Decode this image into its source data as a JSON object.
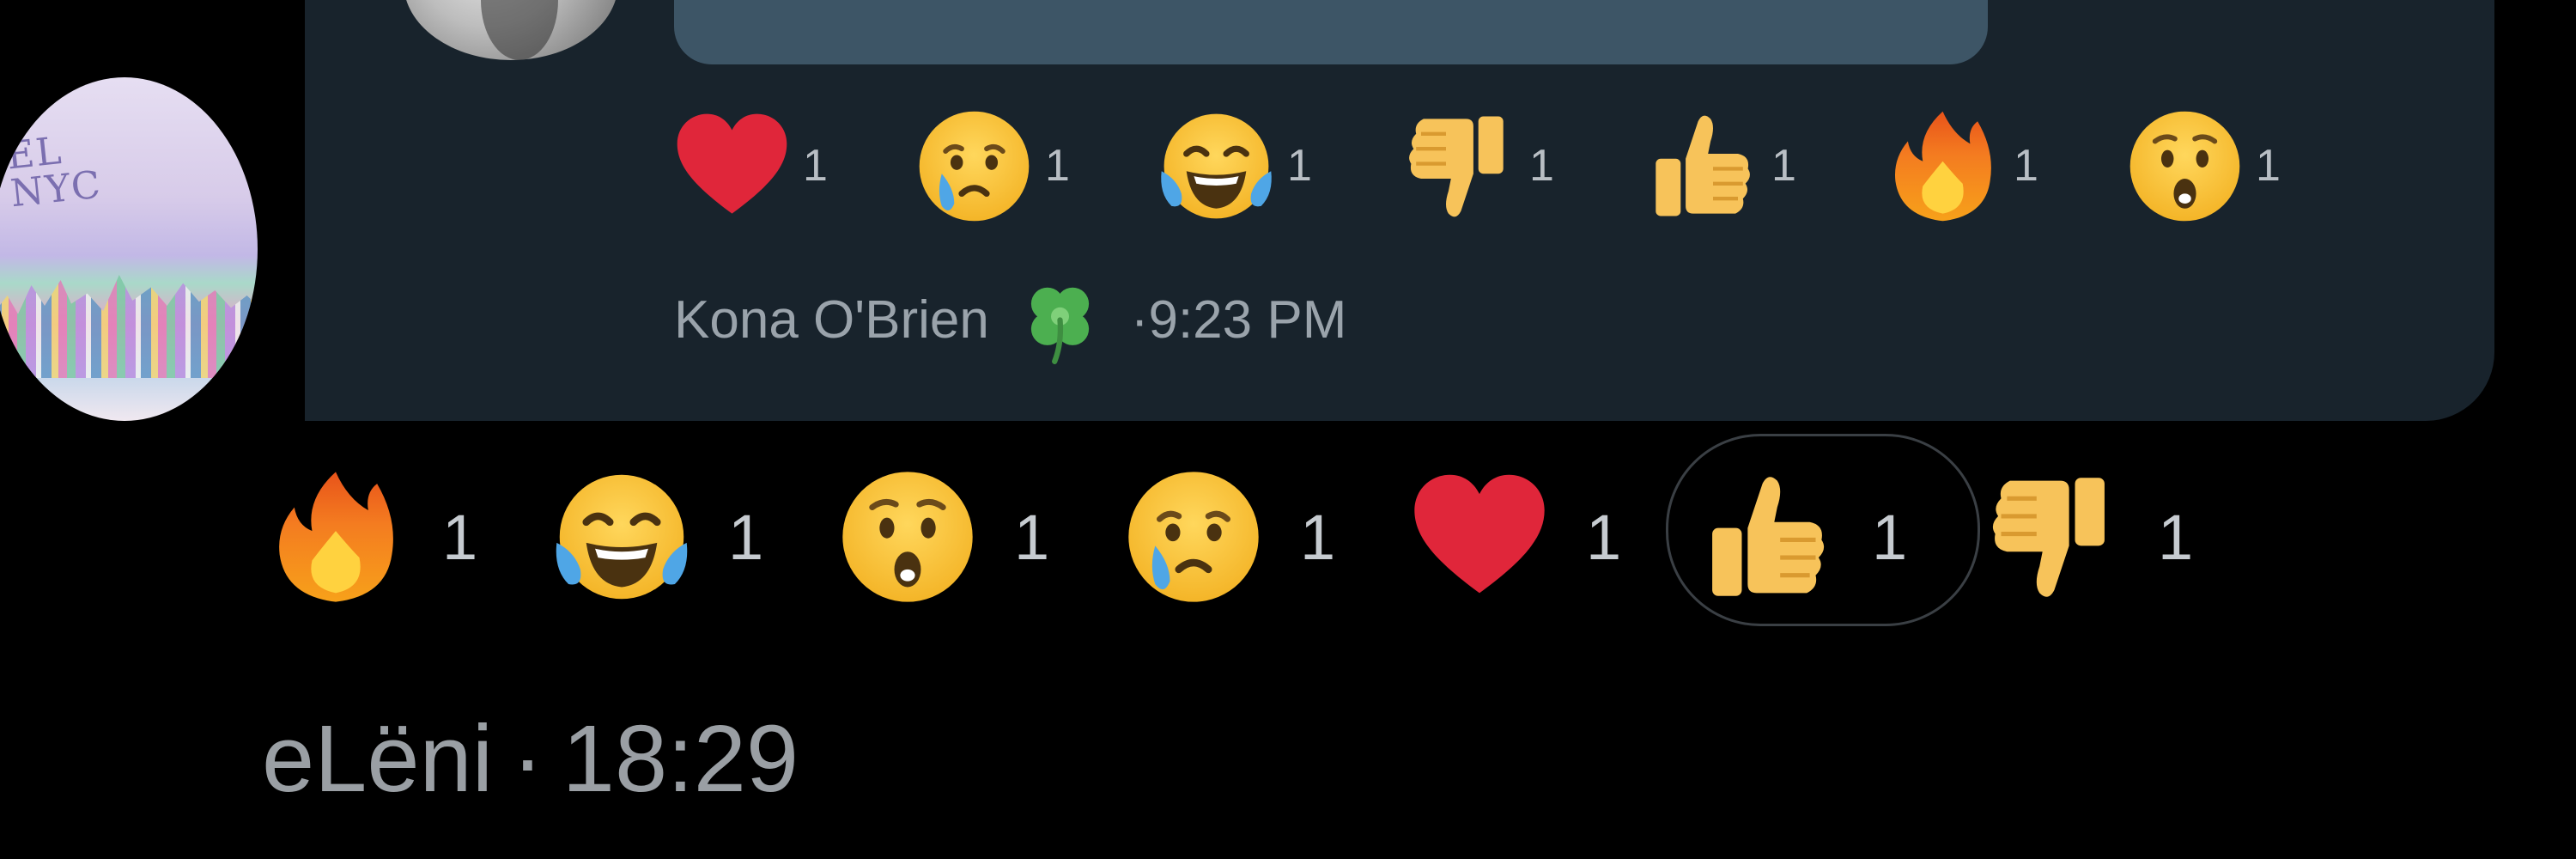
{
  "quoted_message": {
    "reactions": [
      {
        "emoji": "heart-icon",
        "count": "1"
      },
      {
        "emoji": "crying-face-icon",
        "count": "1"
      },
      {
        "emoji": "tears-of-joy-icon",
        "count": "1"
      },
      {
        "emoji": "thumbs-down-icon",
        "count": "1"
      },
      {
        "emoji": "thumbs-up-icon",
        "count": "1"
      },
      {
        "emoji": "fire-icon",
        "count": "1"
      },
      {
        "emoji": "surprised-face-icon",
        "count": "1"
      }
    ],
    "author": "Kona O'Brien",
    "author_badge": "four-leaf-clover-icon",
    "time": "·9:23 PM"
  },
  "message": {
    "reactions": [
      {
        "emoji": "fire-icon",
        "count": "1",
        "selected": false
      },
      {
        "emoji": "tears-of-joy-icon",
        "count": "1",
        "selected": false
      },
      {
        "emoji": "surprised-face-icon",
        "count": "1",
        "selected": false
      },
      {
        "emoji": "crying-face-icon",
        "count": "1",
        "selected": false
      },
      {
        "emoji": "heart-icon",
        "count": "1",
        "selected": false
      },
      {
        "emoji": "thumbs-up-icon",
        "count": "1",
        "selected": true
      },
      {
        "emoji": "thumbs-down-icon",
        "count": "1",
        "selected": false
      }
    ],
    "author": "eLëni",
    "separator": "·",
    "time": "18:29"
  },
  "avatar": {
    "scribble_line1": "EL",
    "scribble_line2": "NYC"
  },
  "colors": {
    "background": "#000000",
    "card": "#18232c",
    "media": "#3d5566",
    "text_secondary": "#9aa3ab"
  }
}
